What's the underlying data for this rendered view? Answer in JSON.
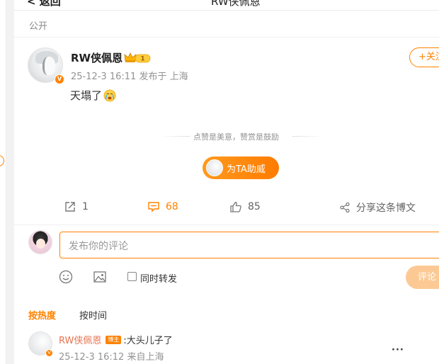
{
  "topbar": {
    "back_label": "返回",
    "title": "RW侠佩恩"
  },
  "post": {
    "visibility": "公开",
    "author": "RW侠佩恩",
    "verified_badge": "V",
    "crown_level": "1",
    "timestamp": "25-12-3 16:11",
    "location": "发布于 上海",
    "follow_label": "+关注",
    "text": "天塌了",
    "emoji": "crying-emoji"
  },
  "reward": {
    "prompt": "点赞是美意，赞赏是鼓励",
    "button_label": "为TA助威"
  },
  "actions": {
    "repost_count": "1",
    "comment_count": "68",
    "like_count": "85",
    "share_label": "分享这条博文"
  },
  "composer": {
    "placeholder": "发布你的评论",
    "repost_label": "同时转发",
    "submit_label": "评论"
  },
  "sort_tabs": {
    "hot": "按热度",
    "time": "按时间"
  },
  "comments": [
    {
      "author": "RW侠佩恩",
      "tag": "博主",
      "verified_badge": "V",
      "text": ":大头儿子了",
      "timestamp": "25-12-3 16:12",
      "location": "来自上海",
      "more": "···"
    }
  ],
  "colors": {
    "accent": "#ff8200",
    "author_link": "#eb7350",
    "muted": "#939393"
  }
}
